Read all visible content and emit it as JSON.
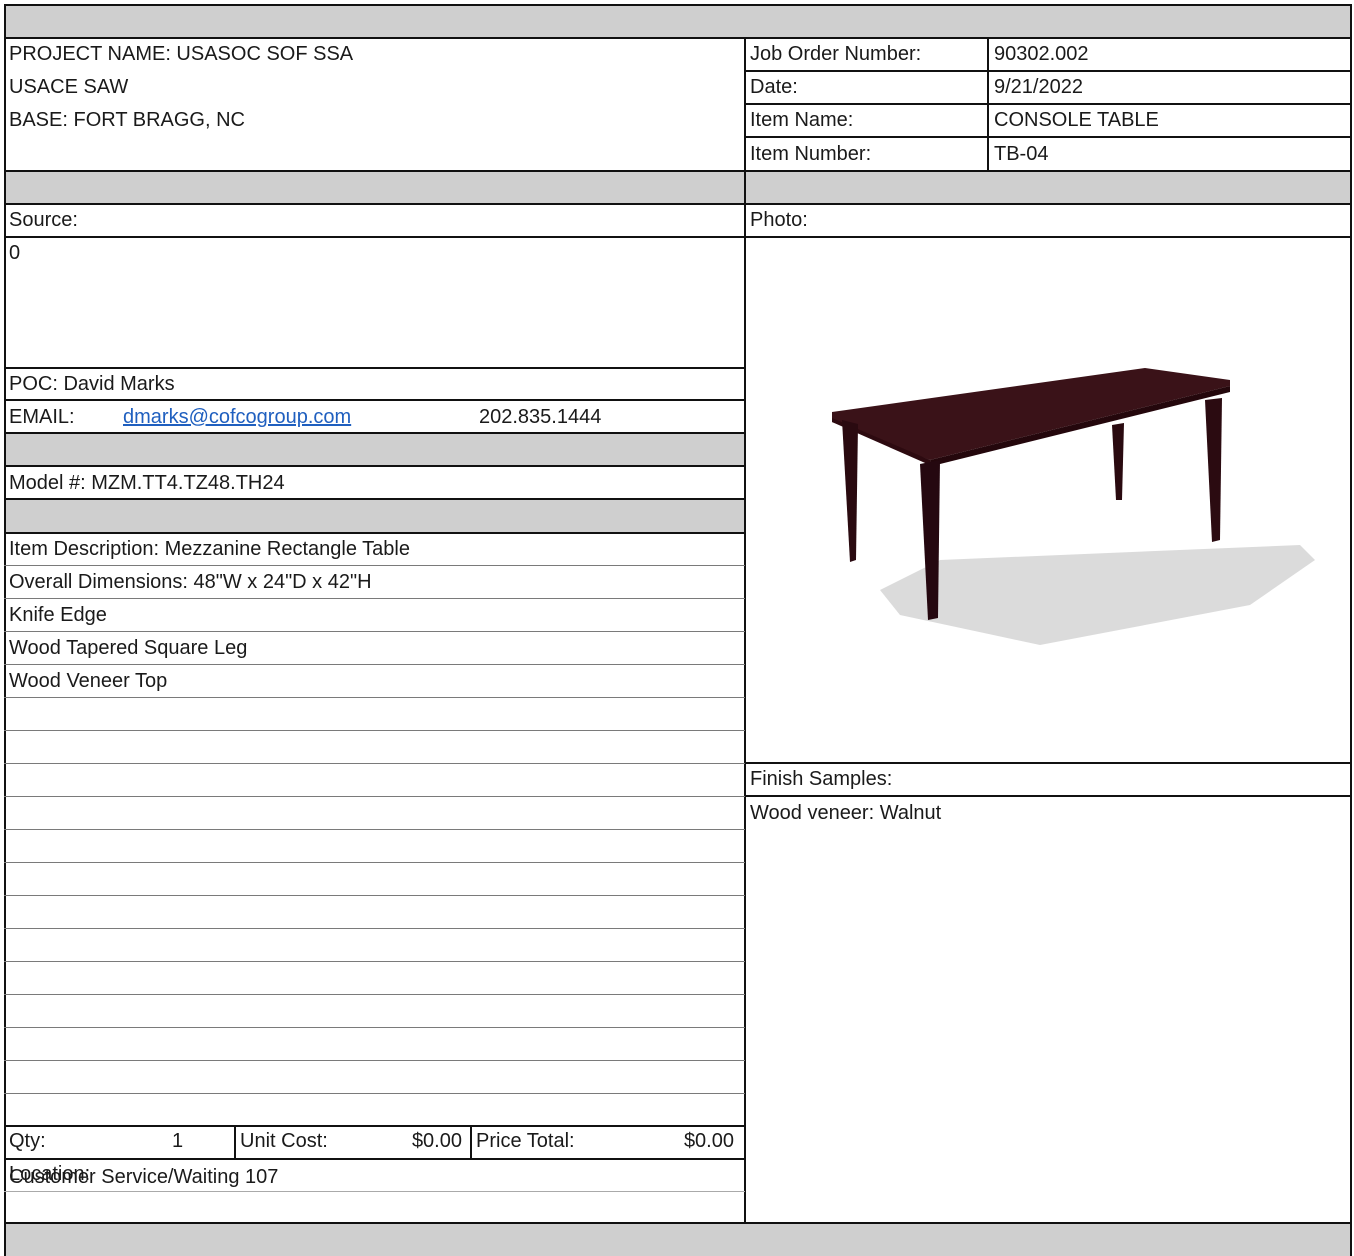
{
  "project": {
    "name": "PROJECT NAME: USASOC SOF SSA",
    "agency": "USACE SAW",
    "base": "BASE: FORT BRAGG, NC"
  },
  "job": {
    "order_label": "Job Order Number:",
    "order_value": "90302.002",
    "date_label": "Date:",
    "date_value": "9/21/2022",
    "item_name_label": "Item Name:",
    "item_name_value": "CONSOLE TABLE",
    "item_number_label": "Item Number:",
    "item_number_value": "TB-04"
  },
  "source": {
    "label": "Source:",
    "value": "0",
    "poc": "POC: David Marks",
    "email_label": "EMAIL:",
    "email": "dmarks@cofcogroup.com",
    "phone": "202.835.1444"
  },
  "model": "Model #: MZM.TT4.TZ48.TH24",
  "description": [
    "Item Description: Mezzanine Rectangle Table",
    "Overall Dimensions: 48\"W x 24\"D x 42\"H",
    "Knife Edge",
    "Wood Tapered Square Leg",
    "Wood Veneer Top"
  ],
  "photo": {
    "label": "Photo:",
    "image": "dark-walnut-rectangle-table-image",
    "wood_color": "#3a1218"
  },
  "finish": {
    "label": "Finish Samples:",
    "value": "Wood veneer: Walnut"
  },
  "pricing": {
    "qty_label": "Qty:",
    "qty_value": "1",
    "unit_cost_label": "Unit Cost:",
    "unit_cost_value": "$0.00",
    "price_total_label": "Price Total:",
    "price_total_value": "$0.00"
  },
  "location": {
    "label": "Location:",
    "value": "Customer Service/Waiting 107"
  },
  "colors": {
    "header_band": "#cfcfcf",
    "link": "#1f5fbf"
  }
}
